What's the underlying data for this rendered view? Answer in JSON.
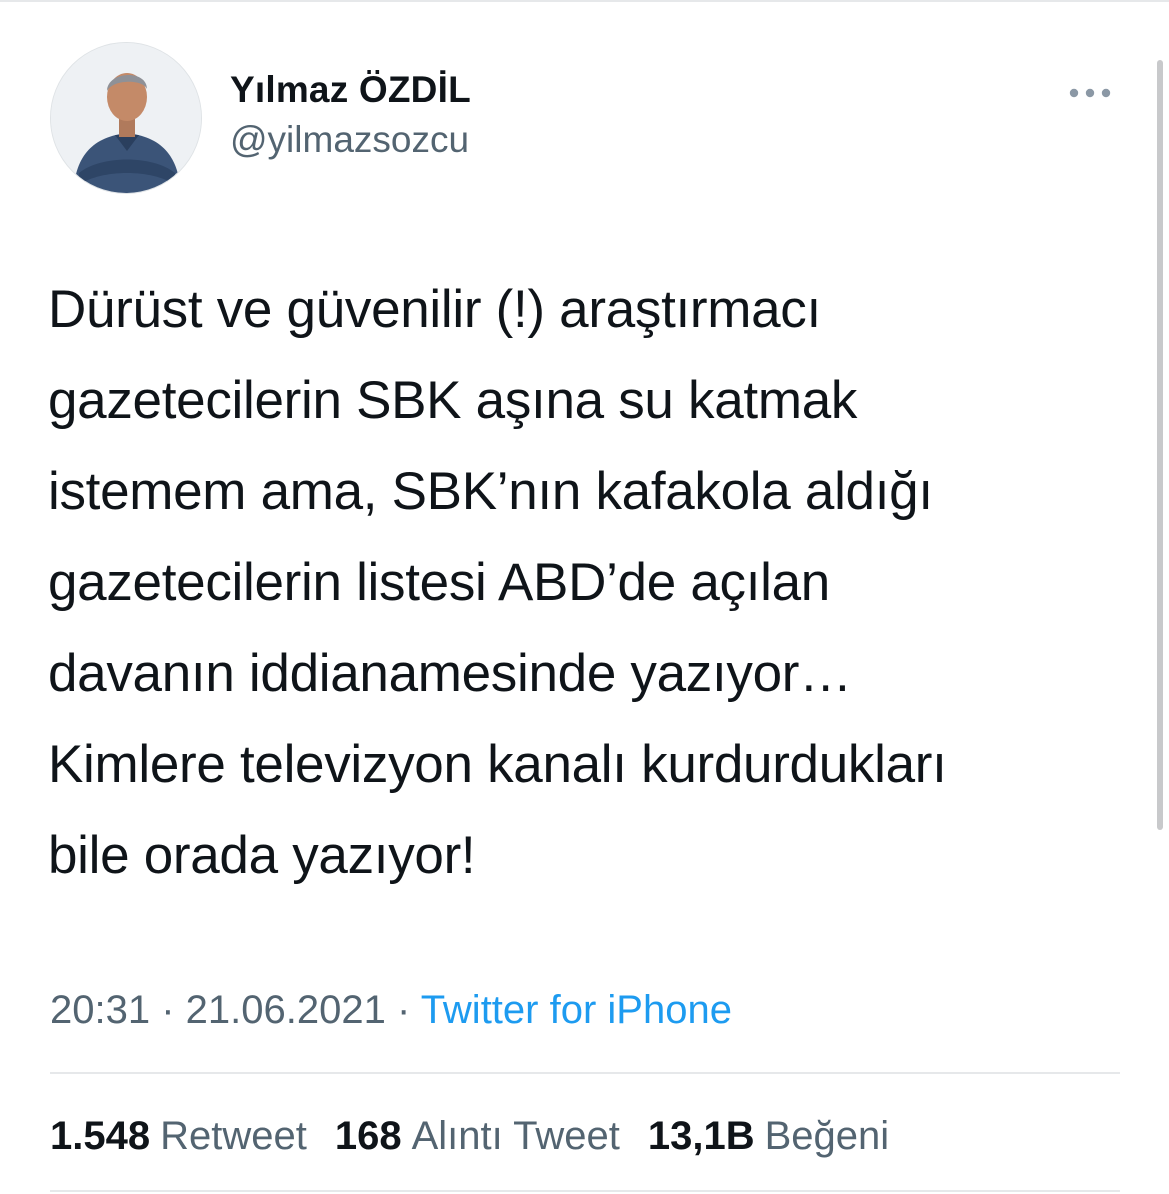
{
  "author": {
    "display_name": "Yılmaz ÖZDİL",
    "handle": "@yilmazsozcu"
  },
  "more_icon": "more-horizontal-icon",
  "tweet": {
    "lines": [
      "Dürüst ve güvenilir (!) araştırmacı",
      "gazetecilerin SBK aşına su katmak",
      "istemem ama, SBK’nın kafakola aldığı",
      "gazetecilerin listesi ABD’de açılan",
      "davanın iddianamesinde yazıyor…",
      "Kimlere televizyon kanalı kurdurdukları",
      "bile orada yazıyor!"
    ]
  },
  "meta": {
    "time": "20:31",
    "separator": " · ",
    "date": "21.06.2021",
    "source": "Twitter for iPhone"
  },
  "stats": [
    {
      "count": "1.548",
      "label": "Retweet"
    },
    {
      "count": "168",
      "label": "Alıntı Tweet"
    },
    {
      "count": "13,1B",
      "label": "Beğeni"
    }
  ],
  "colors": {
    "text_primary": "#0f1419",
    "text_secondary": "#536471",
    "link": "#1d9bf0",
    "divider": "#e6e8ea"
  }
}
